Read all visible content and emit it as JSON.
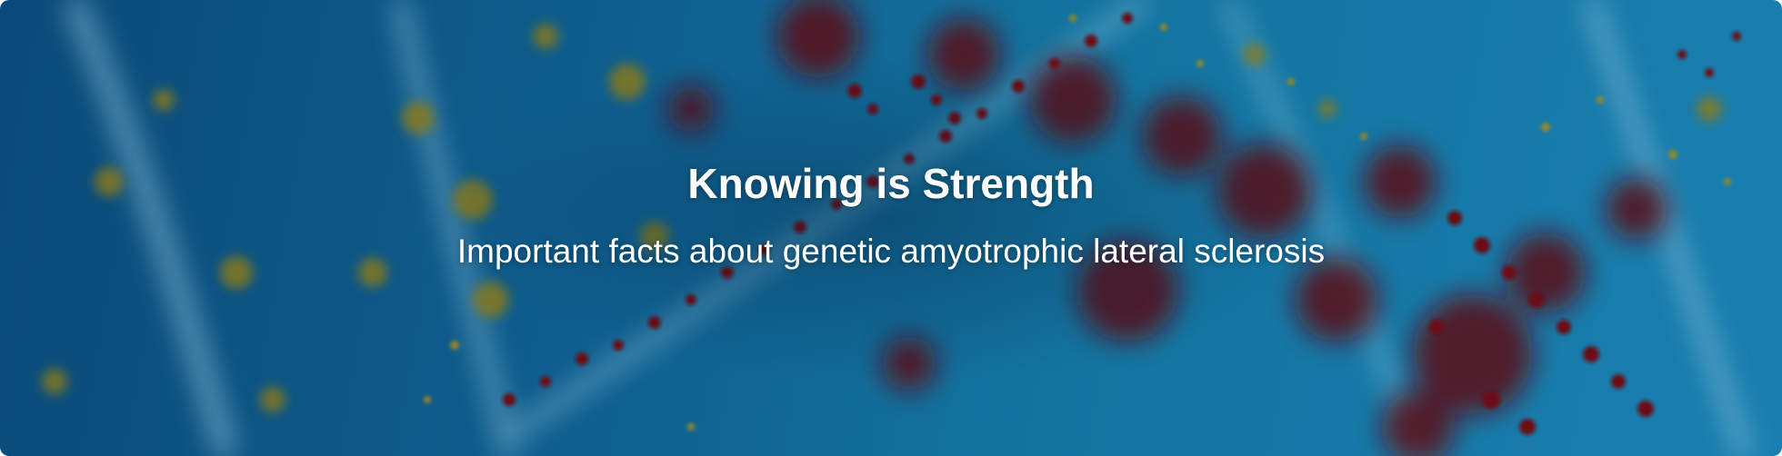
{
  "hero": {
    "title": "Knowing is Strength",
    "subtitle": "Important facts about genetic amyotrophic lateral sclerosis",
    "background_image": "dna-helix-blurred"
  },
  "colors": {
    "background_blue": "#0f5f8f",
    "particle_red": "#6b0a14",
    "particle_gold": "#8a7a14",
    "strand_light": "#7fb6cf",
    "text": "#ffffff"
  }
}
